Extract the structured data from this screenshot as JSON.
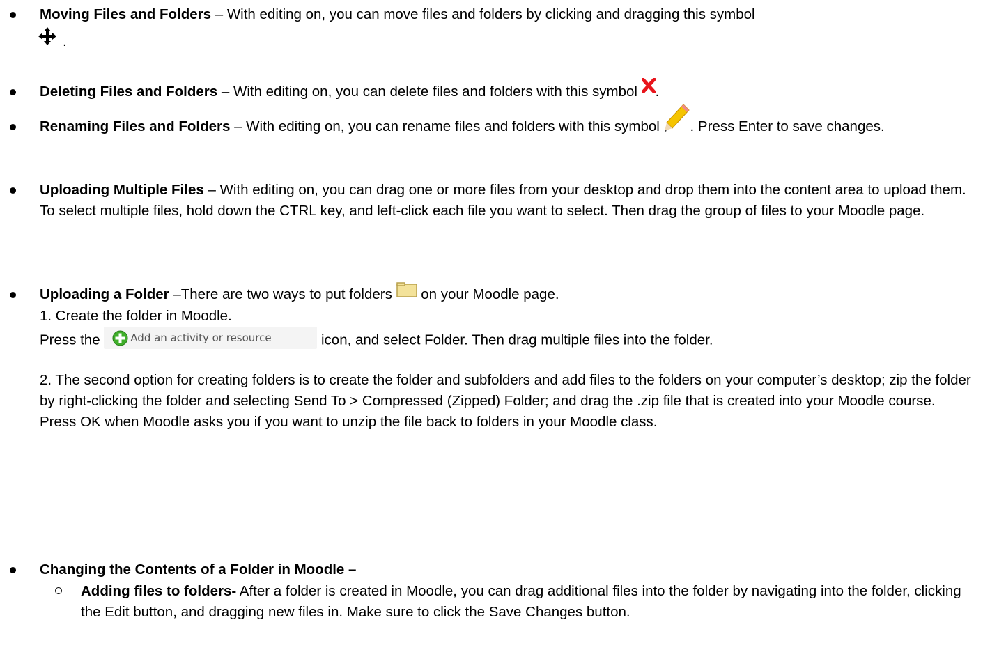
{
  "items": {
    "moving": {
      "title": "Moving Files and Folders",
      "text": " – With editing on, you can move files and folders by clicking and dragging this symbol"
    },
    "deleting": {
      "title": "Deleting Files and Folders",
      "text": " – With editing on, you can delete files and folders with this symbol "
    },
    "renaming": {
      "title": "Renaming Files and Folders",
      "text": " – With editing on, you can rename files and folders with this symbol ",
      "text2": ".  Press Enter to save changes."
    },
    "uploading_multiple": {
      "title": "Uploading Multiple Files",
      "text": " – With editing on, you can drag one or more files from your desktop and drop them into the content area to upload them. To select multiple files, hold down the CTRL key, and left-click each file you want to select. Then drag the group of files to your Moodle page."
    },
    "uploading_folder": {
      "title": "Uploading a Folder",
      "text": " –There are two ways to put folders ",
      "text2": " on your Moodle page.",
      "step1": "1. Create the folder in Moodle.",
      "press_the": "Press the ",
      "button_label": "Add an activity or resource",
      "after_button": " icon, and select Folder. Then drag multiple files into the folder.",
      "step2": "2. The second option for creating folders is to create the folder and subfolders and add files to the folders on your computer’s desktop; zip the folder by right-clicking the folder and selecting Send To > Compressed (Zipped) Folder; and drag the .zip file that is created into your Moodle course. Press OK when Moodle asks you if you want to unzip the file back to folders in your Moodle class."
    },
    "changing": {
      "title": "Changing the Contents of a Folder in Moodle –",
      "sub_title": "Adding files to folders-",
      "sub_text": " After a folder is created in Moodle, you can drag additional files into the folder by navigating into the folder, clicking the Edit button, and dragging new files in. Make sure to click the Save Changes button."
    }
  },
  "icons": {
    "move": "move-arrows-icon",
    "delete": "red-x-icon",
    "rename": "pencil-icon",
    "folder": "folder-icon",
    "add": "green-plus-icon"
  },
  "colors": {
    "delete": "#e8141b",
    "folder": "#f3e29a",
    "add": "#3fae2a"
  }
}
